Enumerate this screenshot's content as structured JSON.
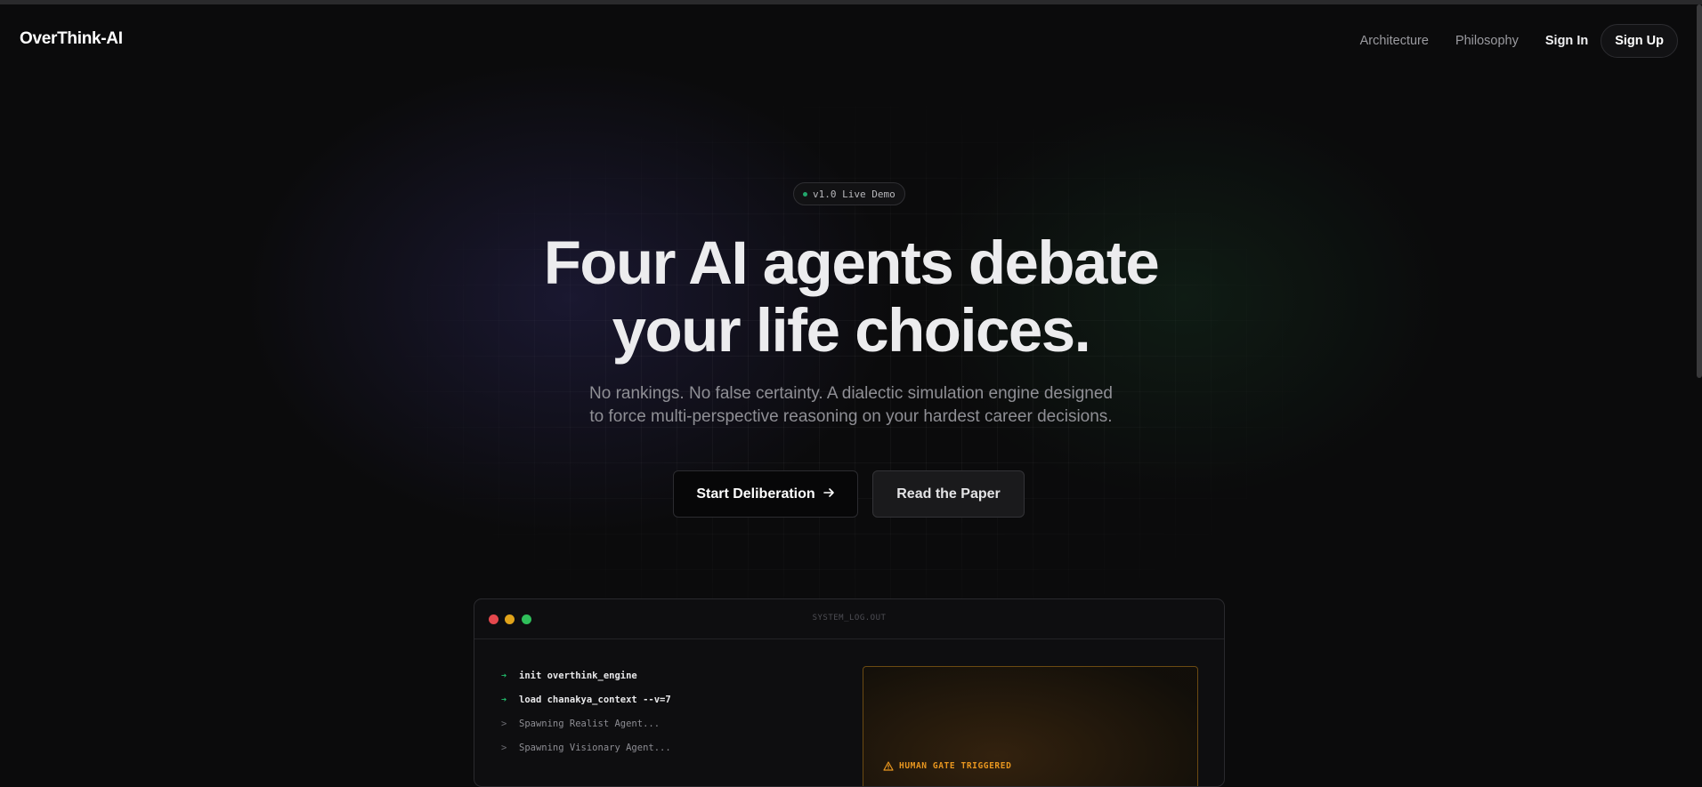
{
  "nav": {
    "logo": "OverThink-AI",
    "links": [
      "Architecture",
      "Philosophy"
    ],
    "sign_in": "Sign In",
    "sign_up": "Sign Up"
  },
  "hero": {
    "badge": "v1.0 Live Demo",
    "headline_line1": "Four AI agents debate",
    "headline_line2": "your life choices.",
    "subtitle_line1": "No rankings. No false certainty. A dialectic simulation engine designed",
    "subtitle_line2": "to force multi-perspective reasoning on your hardest career decisions.",
    "primary_cta": "Start Deliberation",
    "primary_cta_icon": "arrow-right-icon",
    "secondary_cta": "Read the Paper"
  },
  "terminal": {
    "title": "SYSTEM_LOG.OUT",
    "lines": [
      {
        "marker": "➔",
        "text": "init overthink_engine"
      },
      {
        "marker": "➔",
        "text": "load chanakya_context --v=7"
      },
      {
        "marker": ">",
        "text": "Spawning Realist Agent..."
      },
      {
        "marker": ">",
        "text": "Spawning Visionary Agent..."
      }
    ],
    "gate_label": "HUMAN GATE TRIGGERED"
  },
  "colors": {
    "accent_green": "#22c06e",
    "warning_amber": "#e8961f",
    "background": "#0b0b0c"
  }
}
